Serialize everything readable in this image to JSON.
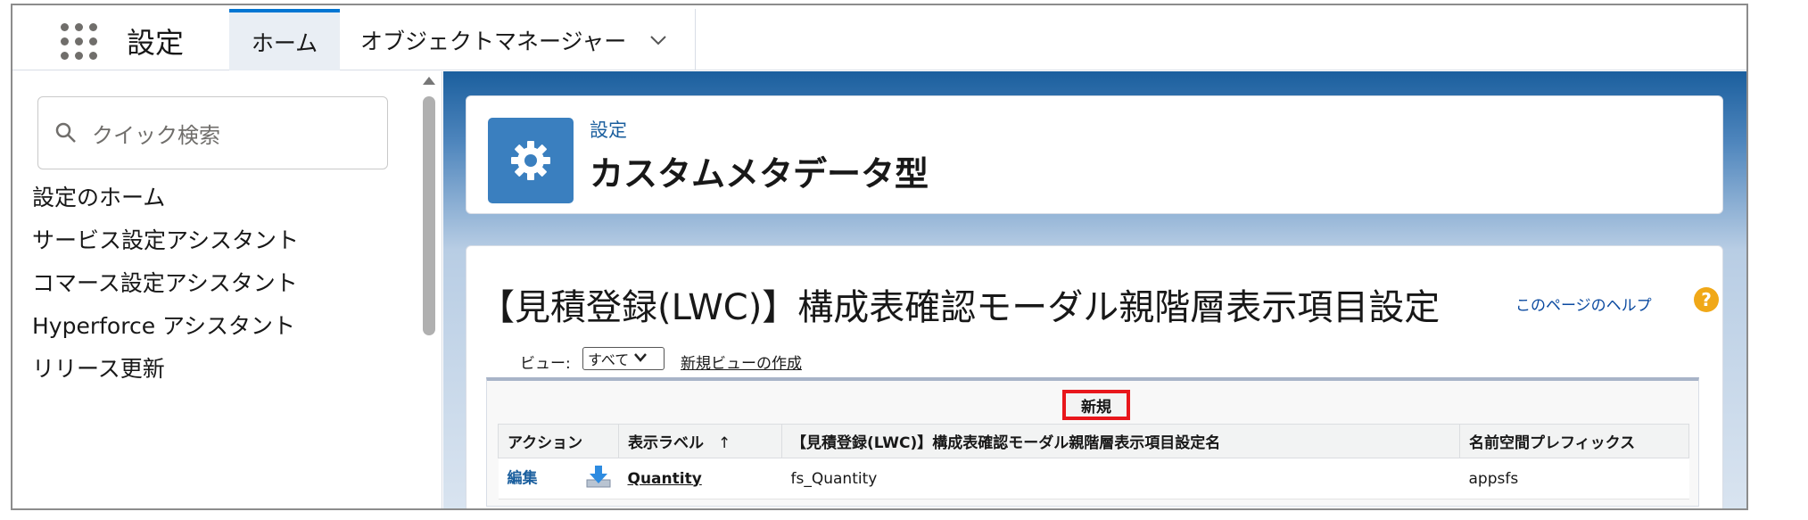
{
  "header": {
    "app_name": "設定",
    "tabs": [
      {
        "label": "ホーム",
        "active": true
      },
      {
        "label": "オブジェクトマネージャー",
        "active": false
      }
    ]
  },
  "sidebar": {
    "search_placeholder": "クイック検索",
    "items": [
      {
        "label": "設定のホーム"
      },
      {
        "label": "サービス設定アシスタント"
      },
      {
        "label": "コマース設定アシスタント"
      },
      {
        "label": "Hyperforce アシスタント"
      },
      {
        "label": "リリース更新"
      }
    ]
  },
  "page_header": {
    "breadcrumb": "設定",
    "title": "カスタムメタデータ型",
    "icon": "gear-icon"
  },
  "list_view": {
    "title": "【見積登録(LWC)】構成表確認モーダル親階層表示項目設定",
    "help_text": "このページのヘルプ",
    "view_label": "ビュー:",
    "view_selected": "すべて",
    "new_view_link": "新規ビューの作成",
    "new_button": "新規",
    "columns": [
      "アクション",
      "表示ラベル",
      "【見積登録(LWC)】構成表確認モーダル親階層表示項目設定名",
      "名前空間プレフィックス"
    ],
    "sort_indicator": "↑",
    "rows": [
      {
        "action": "編集",
        "label": "Quantity",
        "name": "fs_Quantity",
        "namespace": "appsfs"
      }
    ]
  },
  "colors": {
    "brand_blue": "#1b5f9e",
    "tab_active_border": "#0176d3",
    "highlight_red": "#e8161b",
    "help_orange": "#f0a818"
  }
}
